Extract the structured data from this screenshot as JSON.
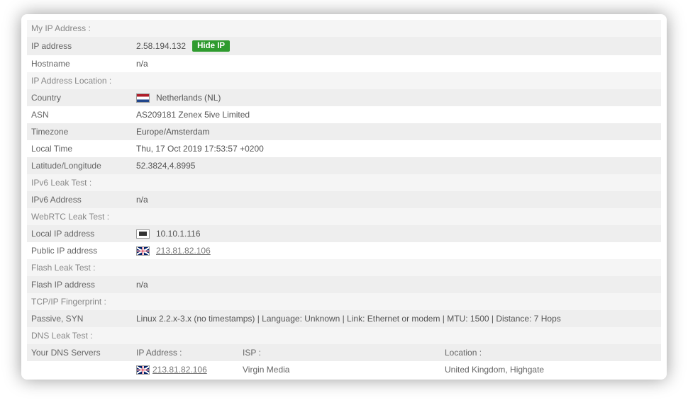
{
  "sections": {
    "myip": {
      "title": "My IP Address :",
      "ip_label": "IP address",
      "ip_value": "2.58.194.132",
      "hide_ip_label": "Hide IP",
      "hostname_label": "Hostname",
      "hostname_value": "n/a"
    },
    "location": {
      "title": "IP Address Location :",
      "country_label": "Country",
      "country_value": "Netherlands (NL)",
      "asn_label": "ASN",
      "asn_value": "AS209181 Zenex 5ive Limited",
      "timezone_label": "Timezone",
      "timezone_value": "Europe/Amsterdam",
      "localtime_label": "Local Time",
      "localtime_value": "Thu, 17 Oct 2019 17:53:57 +0200",
      "latlng_label": "Latitude/Longitude",
      "latlng_value": "52.3824,4.8995"
    },
    "ipv6": {
      "title": "IPv6 Leak Test :",
      "addr_label": "IPv6 Address",
      "addr_value": "n/a"
    },
    "webrtc": {
      "title": "WebRTC Leak Test :",
      "local_label": "Local IP address",
      "local_value": "10.10.1.116",
      "public_label": "Public IP address",
      "public_value": "213.81.82.106"
    },
    "flash": {
      "title": "Flash Leak Test :",
      "addr_label": "Flash IP address",
      "addr_value": "n/a"
    },
    "tcpip": {
      "title": "TCP/IP Fingerprint :",
      "passive_label": "Passive, SYN",
      "passive_value": "Linux 2.2.x-3.x (no timestamps) | Language: Unknown | Link: Ethernet or modem | MTU: 1500 | Distance: 7 Hops"
    },
    "dns": {
      "title": "DNS Leak Test :",
      "servers_label": "Your DNS Servers",
      "col_ip": "IP Address :",
      "col_isp": "ISP :",
      "col_loc": "Location :",
      "row_ip": "213.81.82.106",
      "row_isp": "Virgin Media",
      "row_loc": "United Kingdom, Highgate"
    }
  }
}
